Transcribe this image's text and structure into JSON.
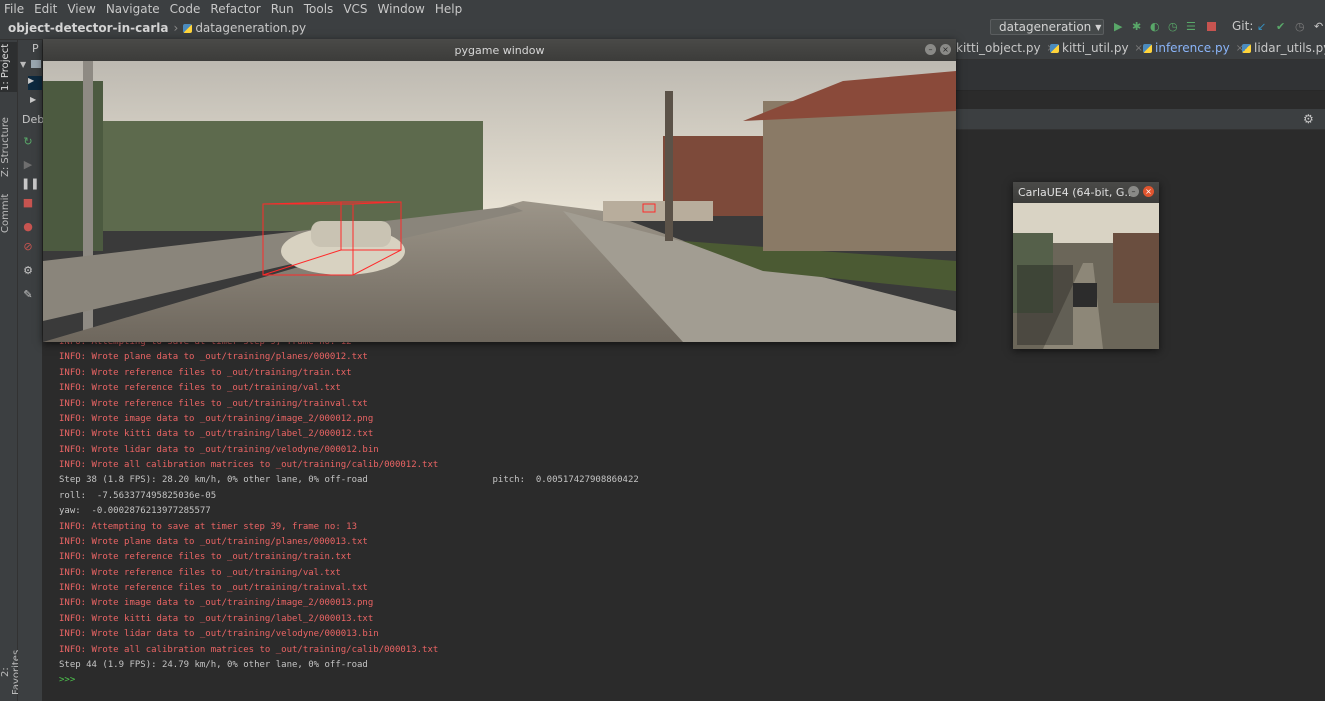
{
  "menu": [
    "File",
    "Edit",
    "View",
    "Navigate",
    "Code",
    "Refactor",
    "Run",
    "Tools",
    "VCS",
    "Window",
    "Help"
  ],
  "breadcrumb": {
    "project": "object-detector-in-carla",
    "file": "datageneration.py"
  },
  "run_config": {
    "name": "datageneration",
    "git_label": "Git:"
  },
  "editor_tabs": [
    {
      "label": "kitti_object.py",
      "active": false
    },
    {
      "label": "kitti_util.py",
      "active": false
    },
    {
      "label": "inference.py",
      "active": true
    },
    {
      "label": "lidar_utils.py",
      "active": false
    }
  ],
  "left_tabs": {
    "project": "1: Project",
    "structure": "Z: Structure",
    "commit": "Commit",
    "favorites": "2: Favorites"
  },
  "panel_partial": {
    "tab_fragment": "P",
    "debug_fragment": "Debu"
  },
  "pygame_window": {
    "title": "pygame window"
  },
  "carla_window": {
    "title": "CarlaUE4 (64-bit, G..."
  },
  "console": [
    {
      "text": "INFO: Attempting to save at timer step 9, frame no: 12",
      "kind": "info"
    },
    {
      "text": "INFO: Wrote plane data to _out/training/planes/000012.txt",
      "kind": "info"
    },
    {
      "text": "INFO: Wrote reference files to _out/training/train.txt",
      "kind": "info"
    },
    {
      "text": "INFO: Wrote reference files to _out/training/val.txt",
      "kind": "info"
    },
    {
      "text": "INFO: Wrote reference files to _out/training/trainval.txt",
      "kind": "info"
    },
    {
      "text": "INFO: Wrote image data to _out/training/image_2/000012.png",
      "kind": "info"
    },
    {
      "text": "INFO: Wrote kitti data to _out/training/label_2/000012.txt",
      "kind": "info"
    },
    {
      "text": "INFO: Wrote lidar data to _out/training/velodyne/000012.bin",
      "kind": "info"
    },
    {
      "text": "INFO: Wrote all calibration matrices to _out/training/calib/000012.txt",
      "kind": "info"
    },
    {
      "text": "Step 38 (1.8 FPS): 28.20 km/h, 0% other lane, 0% off-road                       pitch:  0.00517427908860422",
      "kind": "plain"
    },
    {
      "text": "roll:  -7.563377495825036e-05",
      "kind": "plain"
    },
    {
      "text": "yaw:  -0.0002876213977285577",
      "kind": "plain"
    },
    {
      "text": "INFO: Attempting to save at timer step 39, frame no: 13",
      "kind": "info"
    },
    {
      "text": "INFO: Wrote plane data to _out/training/planes/000013.txt",
      "kind": "info"
    },
    {
      "text": "INFO: Wrote reference files to _out/training/train.txt",
      "kind": "info"
    },
    {
      "text": "INFO: Wrote reference files to _out/training/val.txt",
      "kind": "info"
    },
    {
      "text": "INFO: Wrote reference files to _out/training/trainval.txt",
      "kind": "info"
    },
    {
      "text": "INFO: Wrote image data to _out/training/image_2/000013.png",
      "kind": "info"
    },
    {
      "text": "INFO: Wrote kitti data to _out/training/label_2/000013.txt",
      "kind": "info"
    },
    {
      "text": "INFO: Wrote lidar data to _out/training/velodyne/000013.bin",
      "kind": "info"
    },
    {
      "text": "INFO: Wrote all calibration matrices to _out/training/calib/000013.txt",
      "kind": "info"
    },
    {
      "text": "Step 44 (1.9 FPS): 24.79 km/h, 0% other lane, 0% off-road",
      "kind": "plain"
    },
    {
      "text": ">>>",
      "kind": "prompt"
    }
  ],
  "colors": {
    "ide_bg": "#2b2b2b",
    "panel_bg": "#3c3f41",
    "info_text": "#ea6464",
    "prompt": "#4ec34e",
    "bbox": "#ff2a2a"
  }
}
